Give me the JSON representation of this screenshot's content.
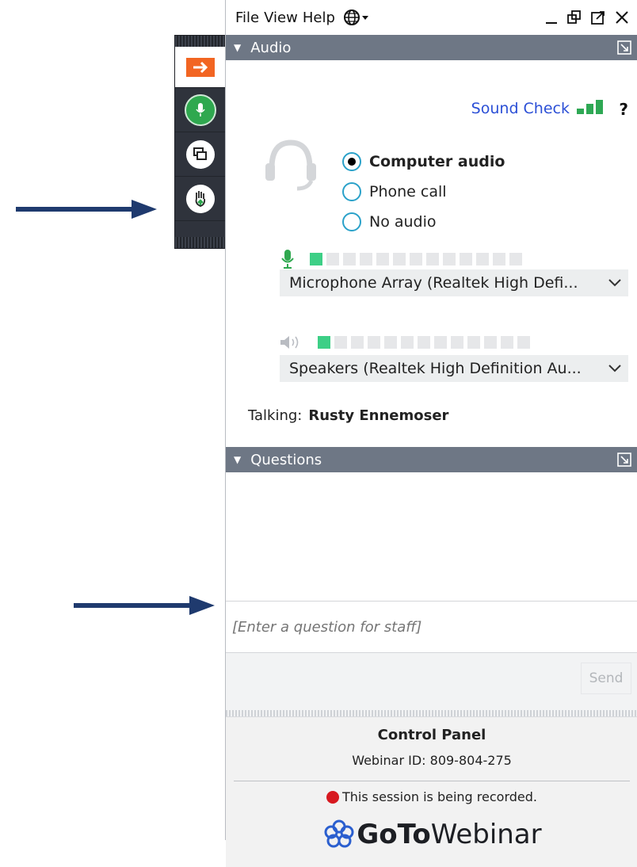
{
  "menubar": {
    "items": [
      "File",
      "View",
      "Help"
    ],
    "language_icon": "globe-icon"
  },
  "window_controls": [
    "minimize-icon",
    "restore-icon",
    "popout-icon",
    "close-icon"
  ],
  "toolbar": {
    "buttons": [
      "exit-arrow-icon",
      "microphone-icon",
      "screen-icon",
      "raise-hand-icon"
    ]
  },
  "audio": {
    "title": "Audio",
    "sound_check": "Sound Check",
    "help": "?",
    "options": [
      {
        "label": "Computer audio",
        "selected": true
      },
      {
        "label": "Phone call",
        "selected": false
      },
      {
        "label": "No audio",
        "selected": false
      }
    ],
    "microphone": {
      "device": "Microphone Array (Realtek High Defi...",
      "level_segments": 13,
      "level_active": 1
    },
    "speakers": {
      "device": "Speakers (Realtek High Definition Au...",
      "level_segments": 13,
      "level_active": 1
    },
    "talking_label": "Talking:",
    "talking_name": "Rusty Ennemoser"
  },
  "questions": {
    "title": "Questions",
    "placeholder": "[Enter a question for staff]",
    "send_label": "Send"
  },
  "footer": {
    "title": "Control Panel",
    "webinar_id": "Webinar ID: 809-804-275",
    "recorded": "This session is being recorded.",
    "brand_goto": "GoTo",
    "brand_webinar": "Webinar"
  },
  "colors": {
    "accent_orange": "#f26522",
    "mic_green": "#2fa84f",
    "header_gray": "#6e7785",
    "link_blue": "#2b4fd6",
    "record_red": "#d71920",
    "arrow_navy": "#1f3a6e"
  }
}
